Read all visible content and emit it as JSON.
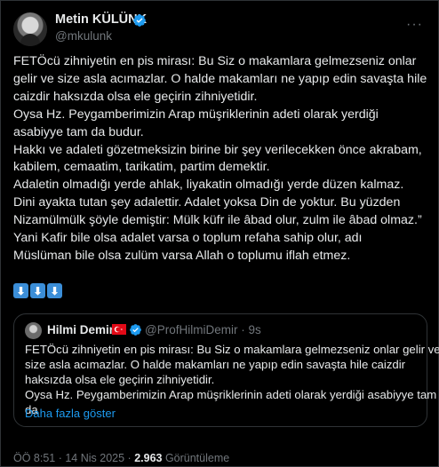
{
  "author": {
    "name": "Metin KÜLÜNK",
    "handle": "@mkulunk",
    "more_icon": "more-icon"
  },
  "tweet": {
    "lines": [
      "FETÖcü zihniyetin en pis mirası: Bu Siz o makamlara gelmezseniz onlar",
      "gelir ve size asla acımazlar.  O halde makamları ne yapıp edin savaşta hile",
      "caizdir haksızda olsa ele geçirin zihniyetidir.",
      "Oysa Hz. Peygamberimizin Arap müşriklerinin adeti olarak yerdiği",
      "asabiyye tam da budur.",
      "Hakkı ve adaleti gözetmeksizin birine bir şey verilecekken önce akrabam,",
      "kabilem, cemaatim, tarikatim, partim demektir.",
      "Adaletin olmadığı yerde ahlak, liyakatin olmadığı yerde düzen kalmaz.",
      "Dini ayakta tutan şey adalettir. Adalet yoksa Din de yoktur. Bu yüzden",
      "Nizamülmülk şöyle demiştir: Mülk küfr ile âbad olur, zulm ile âbad olmaz.”",
      "Yani Kafir bile olsa adalet varsa o toplum refaha sahip olur, adı",
      "Müslüman bile olsa zulüm varsa Allah o toplumu iflah etmez."
    ],
    "arrows": [
      "⬇",
      "⬇",
      "⬇"
    ]
  },
  "quote": {
    "name": "Hilmi Demir",
    "handle": "@ProfHilmiDemir · 9s",
    "lines": [
      "FETÖcü zihniyetin en pis mirası: Bu Siz o makamlara gelmezseniz onlar gelir ve",
      "size asla acımazlar.  O halde makamları ne yapıp edin savaşta hile caizdir",
      "haksızda olsa ele geçirin zihniyetidir.",
      "Oysa Hz. Peygamberimizin Arap müşriklerinin adeti olarak yerdiği asabiyye tam",
      "da"
    ],
    "show_more": "Daha fazla göster"
  },
  "meta": {
    "time_date": "ÖÖ 8:51 · 14 Nis 2025 · ",
    "views": "2.963",
    "views_label": " Görüntüleme"
  },
  "colors": {
    "link": "#1d9bf0",
    "verified": "#1d9bf0",
    "muted": "#71767b"
  }
}
